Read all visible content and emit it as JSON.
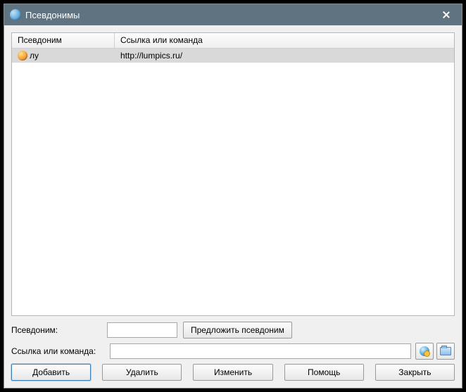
{
  "title": "Псевдонимы",
  "columns": {
    "alias": "Псевдоним",
    "url": "Ссылка или команда"
  },
  "rows": [
    {
      "alias": "лу",
      "url": "http://lumpics.ru/"
    }
  ],
  "form": {
    "alias_label": "Псевдоним:",
    "alias_value": "",
    "suggest_label": "Предложить псевдоним",
    "url_label": "Ссылка или команда:",
    "url_value": ""
  },
  "buttons": {
    "add": "Добавить",
    "delete": "Удалить",
    "edit": "Изменить",
    "help": "Помощь",
    "close": "Закрыть"
  }
}
